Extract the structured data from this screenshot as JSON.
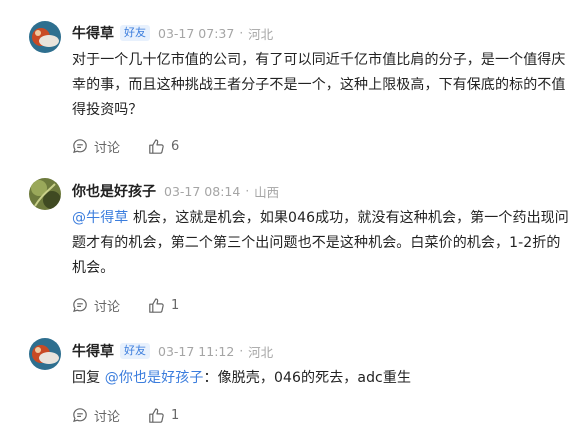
{
  "comments": [
    {
      "username": "牛得草",
      "badge": "好友",
      "time": "03-17 07:37",
      "location": "河北",
      "text": "对于一个几十亿市值的公司，有了可以同近千亿市值比肩的分子，是一个值得庆幸的事，而且这种挑战王者分子不是一个，这种上限极高，下有保底的标的不值得投资吗？",
      "discuss_label": "讨论",
      "like_count": "6"
    },
    {
      "username": "你也是好孩子",
      "time": "03-17 08:14",
      "location": "山西",
      "mention": "@牛得草",
      "text": " 机会，这就是机会，如果046成功，就没有这种机会，第一个药出现问题才有的机会，第二个第三个出问题也不是这种机会。白菜价的机会，1-2折的机会。",
      "discuss_label": "讨论",
      "like_count": "1"
    },
    {
      "username": "牛得草",
      "badge": "好友",
      "time": "03-17 11:12",
      "location": "河北",
      "prefix": "回复 ",
      "mention": "@你也是好孩子",
      "text": "：像脱壳，046的死去，adc重生",
      "discuss_label": "讨论",
      "like_count": "1"
    }
  ],
  "colors": {
    "link": "#3b7ddd",
    "meta": "#a5a5a5",
    "badge_bg": "#e8f1fd"
  },
  "icons": {
    "discuss": "comment-bubble-icon",
    "like": "thumbs-up-icon"
  }
}
